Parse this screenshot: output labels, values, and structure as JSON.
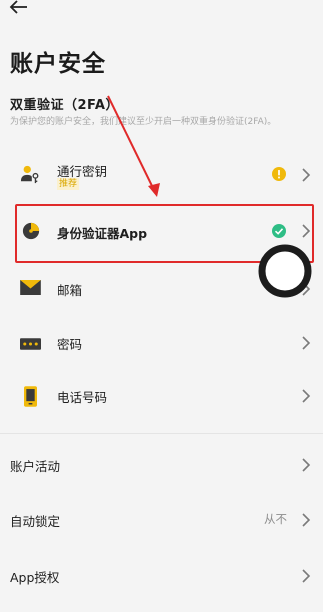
{
  "header": {
    "back_icon": "arrow-left-icon",
    "title": "账户安全"
  },
  "two_factor": {
    "title": "双重验证（2FA）",
    "description": "为保护您的账户安全，我们建议至少开启一种双重身份验证(2FA)。",
    "items": [
      {
        "label": "通行密钥",
        "badge": "推荐",
        "icon": "passkey-icon",
        "status_icon": "warning-icon",
        "status_color": "#f0b90b"
      },
      {
        "label": "身份验证器App",
        "icon": "authenticator-icon",
        "status_icon": "check-circle-icon",
        "status_color": "#2ebd85",
        "highlighted": true
      },
      {
        "label": "邮箱",
        "icon": "mail-icon"
      },
      {
        "label": "密码",
        "icon": "password-icon"
      },
      {
        "label": "电话号码",
        "icon": "phone-icon"
      }
    ]
  },
  "settings": [
    {
      "label": "账户活动"
    },
    {
      "label": "自动锁定",
      "value": "从不"
    },
    {
      "label": "App授权"
    }
  ],
  "colors": {
    "accent": "#f0b90b",
    "annotation_red": "#e02a2a",
    "success": "#2ebd85"
  }
}
